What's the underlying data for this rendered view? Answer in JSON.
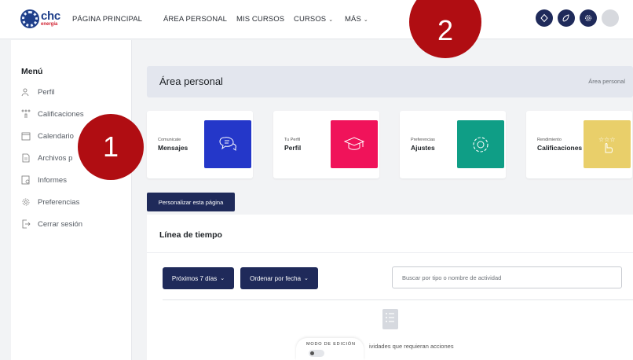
{
  "brand": {
    "name": "chc",
    "tagline": "energía"
  },
  "nav": {
    "home": "PÁGINA PRINCIPAL",
    "personal": "ÁREA PERSONAL",
    "my_courses": "MIS CURSOS",
    "courses": "CURSOS",
    "more": "MÁS"
  },
  "sidebar": {
    "title": "Menú",
    "items": [
      {
        "label": "Perfil",
        "icon": "profile-icon"
      },
      {
        "label": "Calificaciones",
        "icon": "grades-icon"
      },
      {
        "label": "Calendario",
        "icon": "calendar-icon"
      },
      {
        "label": "Archivos p",
        "icon": "files-icon"
      },
      {
        "label": "Informes",
        "icon": "reports-icon"
      },
      {
        "label": "Preferencias",
        "icon": "preferences-icon"
      },
      {
        "label": "Cerrar sesión",
        "icon": "logout-icon"
      }
    ]
  },
  "header": {
    "title": "Área personal",
    "breadcrumb": "Área personal"
  },
  "cards": [
    {
      "small": "Comunicate",
      "big": "Mensajes",
      "color": "#2437c9",
      "icon": "chat-icon"
    },
    {
      "small": "Tu Perfil",
      "big": "Perfil",
      "color": "#f0135a",
      "icon": "graduation-cap-icon"
    },
    {
      "small": "Preferencias",
      "big": "Ajustes",
      "color": "#0f9e86",
      "icon": "gear-icon"
    },
    {
      "small": "Rendimiento",
      "big": "Calificaciones",
      "color": "#e9cf6a",
      "icon": "rating-hand-icon"
    }
  ],
  "customize_button": "Personalizar esta página",
  "timeline": {
    "title": "Línea de tiempo",
    "filter_label": "Próximos 7 días",
    "sort_label": "Ordenar por fecha",
    "search_placeholder": "Buscar por tipo o nombre de actividad",
    "empty_text": "ividades que requieran acciones"
  },
  "edit_mode": {
    "label": "MODO DE EDICIÓN"
  },
  "callouts": {
    "one": "1",
    "two": "2"
  },
  "colors": {
    "primary": "#1f2a5a",
    "callout": "#b00d12",
    "brand": "#1f3f8a"
  }
}
